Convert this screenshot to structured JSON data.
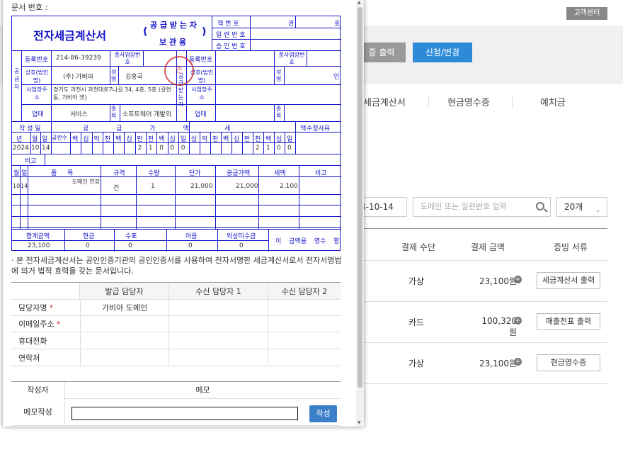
{
  "background": {
    "customer_center": "고객센터",
    "print_btn": "증 출력",
    "apply_btn": "신청/변경",
    "tabs": [
      "세금계산서",
      "현금영수증",
      "예치금"
    ],
    "date_value": "4-10-14",
    "search_placeholder": "도메인 또는 일련번호 입력",
    "page_size": "20개",
    "table_headers": [
      "결제 수단",
      "결제 금액",
      "증빙 서류"
    ],
    "rows": [
      {
        "method": "가상",
        "amount": "23,100원",
        "doc": "세금계산서 출력"
      },
      {
        "method": "카드",
        "amount": "100,320원",
        "doc": "매출전표 출력"
      },
      {
        "method": "가상",
        "amount": "23,100원",
        "doc": "현금영수증"
      }
    ]
  },
  "popup": {
    "doc_no_label": "문서 번호 :",
    "title": "전자세금계산서",
    "receiver_line1": "공 급 받 는 자",
    "receiver_line2": "보 관 용",
    "right_labels": [
      "책 번 호",
      "일 련 번 호",
      "승 인 번 호"
    ],
    "kwon": "권",
    "ho": "호",
    "supplier_vertical": "공급자",
    "receiver_vertical": "공급받는자",
    "reg_no_label": "등록번호",
    "reg_no": "214-86-39239",
    "branch_label": "종사업장번호",
    "trade_name_label": "상호(법인명)",
    "trade_name": "(주) 가비아",
    "name_label": "성명",
    "name": "김홍국",
    "in_mark": "인",
    "addr_label": "사업장주소",
    "address": "경기도 과천시 과천대로7나길 34, 4층, 5층 (갈현동, 가비아 앳)",
    "biz_type_label": "업태",
    "biz_type": "서비스",
    "biz_item_label": "종목",
    "biz_item": "소프트웨어 개발외",
    "stamp_text": "인",
    "written_date": "작 성 일",
    "supply_value": "공 급 가 액",
    "tax_amount": "세 액",
    "modify_reason": "수정사유",
    "date_cols": [
      "년",
      "월",
      "일",
      "공란수"
    ],
    "digit_cols": [
      "백",
      "십",
      "억",
      "천",
      "백",
      "십",
      "만",
      "천",
      "백",
      "십",
      "일"
    ],
    "tax_digit_cols": [
      "십",
      "억",
      "천",
      "백",
      "십",
      "만",
      "천",
      "백",
      "십",
      "일"
    ],
    "date_values": [
      "2024",
      "10",
      "14"
    ],
    "supply_digits": [
      "2",
      "1",
      "0",
      "0",
      "0"
    ],
    "tax_digits": [
      "2",
      "1",
      "0",
      "0"
    ],
    "remarks_label": "비고",
    "item_headers": [
      "월",
      "일",
      "품 목",
      "규격",
      "수량",
      "단가",
      "공급가액",
      "세액",
      "비고"
    ],
    "item": {
      "mm": "10",
      "dd": "14",
      "name": "도메인 연장",
      "unit": "건",
      "qty": "1",
      "price": "21,000",
      "supply": "21,000",
      "tax": "2,100"
    },
    "total_headers": [
      "합계금액",
      "현금",
      "수표",
      "어음",
      "외상미수금"
    ],
    "total_values": [
      "23,100",
      "0",
      "0",
      "0",
      "0"
    ],
    "receipt_note": "이 금액을 영수 함",
    "legal_note": "· 본 전자세금계산서는 공인인증기관의 공인인증서를 사용하여 전자서명한 세금계산서로서 전자서명법에 의거 법적 효력을 갖는 문서입니다.",
    "mgr_headers": [
      "발급 담당자",
      "수신 담당자 1",
      "수신 담당자 2"
    ],
    "mgr_rows": [
      "담당자명",
      "이메일주소",
      "휴대전화",
      "연락처"
    ],
    "required_mark": "*",
    "issuer_name": "가비아 도메인",
    "memo_headers": [
      "작성자",
      "메모"
    ],
    "memo_write": "메모작성",
    "save_btn": "작성"
  },
  "colors": {
    "invoice_line": "#1414c8",
    "blue_button": "#2d8ad8",
    "stamp": "#d03030"
  }
}
